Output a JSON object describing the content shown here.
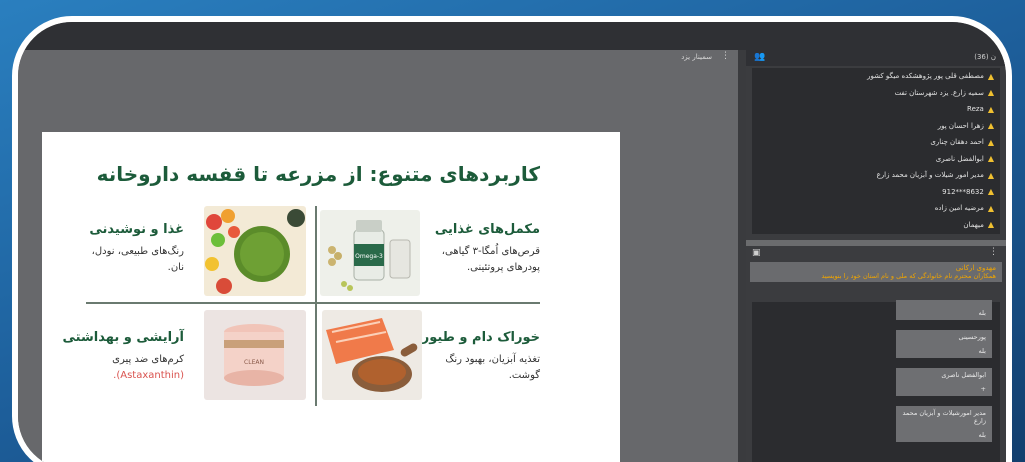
{
  "stage": {
    "title": "سمینار یزد",
    "menu_icon": "⋮"
  },
  "slide": {
    "title": "کاربردهای متنوع: از مزرعه تا قفسه داروخانه",
    "cells": {
      "supplements": {
        "title": "مکمل‌های غذایی",
        "text": "قرص‌های اُمگا-۳ گیاهی، پودرهای پروتئینی."
      },
      "food": {
        "title": "غذا و نوشیدنی",
        "text": "رنگ‌های طبیعی، نودل، نان."
      },
      "feed": {
        "title": "خوراک دام و طیور",
        "text": "تغذیه آبزیان، بهبود رنگ گوشت."
      },
      "cosmetics": {
        "title": "آرایشی و بهداشتی",
        "text_main": "کرم‌های ضد پیری",
        "text_red": "(Astaxanthin)."
      }
    },
    "bottle_label": "Omega-3",
    "jar_label": "CLEAN"
  },
  "people": {
    "count": "ن (36)",
    "list": [
      "مصطفی قلی پور پژوهشکده میگو کشور",
      "سمیه زارع. یزد شهرستان تفت",
      "Reza",
      "زهرا احسان پور",
      "احمد دهقان چناری",
      "ابوالفضل ناصری",
      "مدیر امور شیلات و آبزیان محمد زارع",
      "912***8632",
      "مرضیه امین زاده",
      "میهمان"
    ]
  },
  "chat": {
    "pinned_title": "مهدوی ارکانی",
    "pinned_text": "همکاران محترم نام خانوادگی که ملی و نام استان خود را بنویسید",
    "messages": [
      {
        "name": "",
        "text": "بله"
      },
      {
        "name": "پورحسینی",
        "text": "بله"
      },
      {
        "name": "ابوالفضل ناصری",
        "text": "+"
      },
      {
        "name": "مدیر امورشیلات و آبزیان محمد زارع",
        "text": "بله"
      }
    ]
  }
}
